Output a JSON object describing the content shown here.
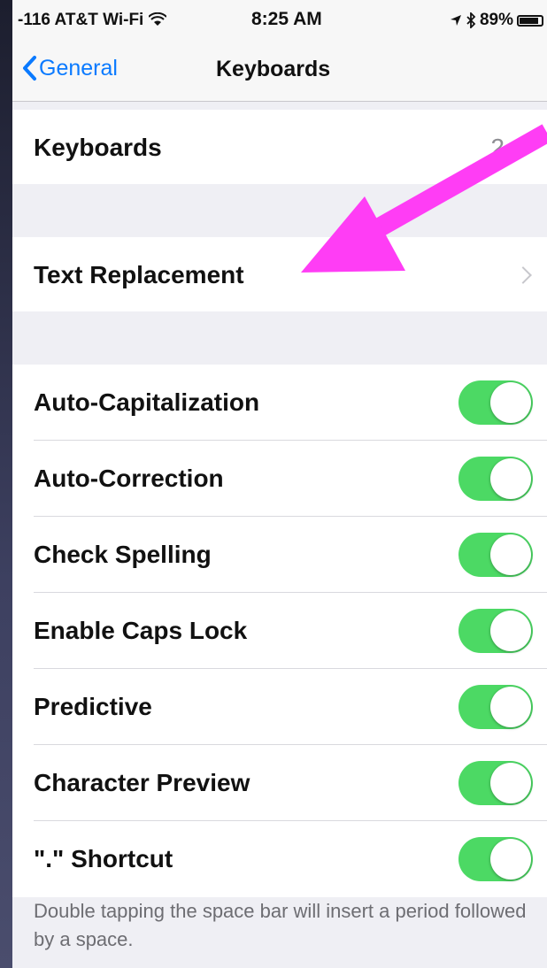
{
  "status_bar": {
    "carrier": "-116 AT&T Wi-Fi",
    "time": "8:25 AM",
    "battery": "89%",
    "battery_level": 0.89
  },
  "nav": {
    "back_label": "General",
    "title": "Keyboards"
  },
  "keyboards_row": {
    "label": "Keyboards",
    "value": "2"
  },
  "text_replacement_row": {
    "label": "Text Replacement"
  },
  "toggles": [
    {
      "label": "Auto-Capitalization",
      "on": true
    },
    {
      "label": "Auto-Correction",
      "on": true
    },
    {
      "label": "Check Spelling",
      "on": true
    },
    {
      "label": "Enable Caps Lock",
      "on": true
    },
    {
      "label": "Predictive",
      "on": true
    },
    {
      "label": "Character Preview",
      "on": true
    },
    {
      "label": "\".\" Shortcut",
      "on": true
    }
  ],
  "footer": "Double tapping the space bar will insert a period followed by a space.",
  "colors": {
    "accent": "#0a7aff",
    "toggle_on": "#4cd964",
    "annotation_arrow": "#ff3df5"
  },
  "icons": [
    "wifi-icon",
    "location-icon",
    "bluetooth-icon",
    "battery-icon",
    "back-chevron-icon",
    "disclosure-chevron-icon",
    "annotation-arrow"
  ]
}
